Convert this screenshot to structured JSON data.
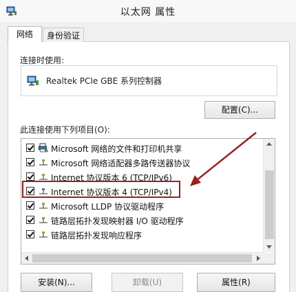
{
  "window": {
    "title": "以太网 属性"
  },
  "tabs": [
    {
      "label": "网络",
      "active": true
    },
    {
      "label": "身份验证",
      "active": false
    }
  ],
  "connection": {
    "label": "连接时使用:",
    "adapter": "Realtek PCIe GBE 系列控制器",
    "configure_button": "配置(C)..."
  },
  "items_section": {
    "label": "此连接使用下列项目(O):",
    "items": [
      {
        "label": "Microsoft 网络的文件和打印机共享",
        "checked": true,
        "icon": "printer-share-icon"
      },
      {
        "label": "Microsoft 网络适配器多路传送器协议",
        "checked": true,
        "icon": "protocol-icon"
      },
      {
        "label": "Internet 协议版本 6 (TCP/IPv6)",
        "checked": true,
        "icon": "protocol-icon"
      },
      {
        "label": "Internet 协议版本 4 (TCP/IPv4)",
        "checked": true,
        "icon": "protocol-icon"
      },
      {
        "label": "Microsoft LLDP 协议驱动程序",
        "checked": true,
        "icon": "protocol-icon"
      },
      {
        "label": "链路层拓扑发现映射器 I/O 驱动程序",
        "checked": true,
        "icon": "protocol-icon"
      },
      {
        "label": "链路层拓扑发现响应程序",
        "checked": true,
        "icon": "protocol-icon"
      }
    ]
  },
  "buttons": {
    "install": "安装(N)...",
    "uninstall": "卸载(U)",
    "properties": "属性(R)"
  },
  "colors": {
    "annotation": "#9a1f1f",
    "panel": "#ffffff",
    "window": "#f0f0f0"
  }
}
